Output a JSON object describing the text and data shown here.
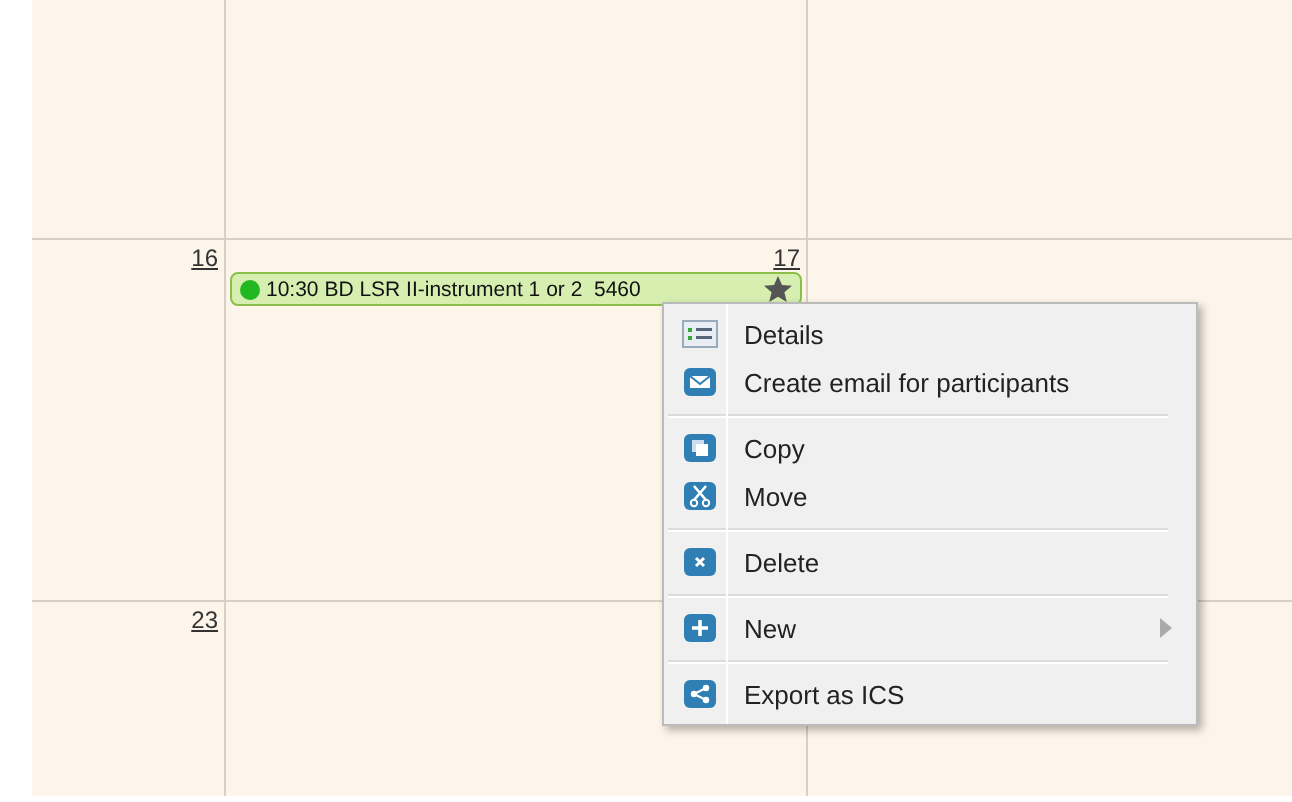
{
  "calendar": {
    "weeks": [
      {
        "days": [
          {
            "label": "16"
          },
          {
            "label": "17"
          }
        ]
      },
      {
        "days": [
          {
            "label": "23"
          }
        ]
      }
    ],
    "event": {
      "text": "10:30 BD LSR II-instrument 1 or 2  5460",
      "color": "#22b822"
    }
  },
  "context_menu": {
    "items": [
      {
        "kind": "details",
        "label": "Details"
      },
      {
        "kind": "email",
        "label": "Create email for participants"
      },
      {
        "kind": "separator"
      },
      {
        "kind": "copy",
        "label": "Copy"
      },
      {
        "kind": "move",
        "label": "Move"
      },
      {
        "kind": "separator"
      },
      {
        "kind": "delete",
        "label": "Delete"
      },
      {
        "kind": "separator"
      },
      {
        "kind": "new",
        "label": "New",
        "submenu": true
      },
      {
        "kind": "separator"
      },
      {
        "kind": "share",
        "label": "Export as ICS"
      }
    ]
  }
}
